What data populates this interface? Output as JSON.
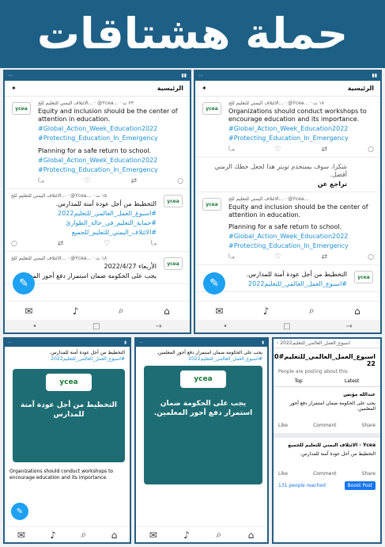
{
  "banner": {
    "title": "حملة هشتاقات"
  },
  "left": {
    "home": "الرئيسية",
    "org": "الائتلاف اليمني للتعليم للج...",
    "handle": "@Ycea...",
    "time": "٢٣ ت",
    "t1": "Equity and inclusion should be the center of attention in education.",
    "tags": [
      "#Global_Action_Week_Education2022",
      "#Protecting_Education_In_Emergency"
    ],
    "t1b": "Planning for a safe return to school.",
    "tags2": [
      "#Global_Action_Week_Education2022",
      "#Protecting_Education_In_Emergency"
    ],
    "meta2": "١٥ ت",
    "t2": "التخطيط من أجل عودة آمنة للمدارس.",
    "tags3": [
      "#اسبوع_العمل_العالمي_للتعليم2022",
      "#حماية_التعليم_في_حالة_الطوارئ",
      "#الائتلاف_اليمني_للتعليم_للجميع"
    ],
    "date": "الأربعاء 2022/4/27",
    "t3": "يجب على الحكومة ضمان استمرار دفع أجور المعلمين.",
    "meta3": "١٨ ت"
  },
  "right": {
    "home": "الرئيسية",
    "org": "الائتلاف اليمني للتعليم للج...",
    "handle": "@Ycea...",
    "time": "١٧ ت",
    "t1": "Organizations should conduct workshops to encourage education and its importance.",
    "tags": [
      "#Global_Action_Week_Education2022",
      "#Protecting_Education_In_Emergency"
    ],
    "note": "شكرا، سوف يستخدم تويتر هذا لجعل خطك الزمني أفضل.",
    "undo": "تراجع عن",
    "t2": "Equity and inclusion should be the center of attention in education.",
    "t2b": "Planning for a safe return to school.",
    "tags2": [
      "#Global_Action_Week_Education2022",
      "#Protecting_Education_In_Emergency"
    ],
    "t3": "التخطيط من أجل عودة آمنة للمدارس.",
    "tag3": "#اسبوع_العمل_العالمي_للتعليم2022"
  },
  "bottom": {
    "a_text": "التخطيط من أجل عودة آمنة للمدارس",
    "a_title": "التخطيط من أجل عودة آمنة للمدارس.",
    "a_tags": "#اسبوع_العمل_العالمي_للتعليم2022",
    "a_eng": "Organizations should conduct workshops to encourage education and its importance.",
    "b_title": "يجب على الحكومة ضمان استمرار دفع أجور المعلمين.",
    "b_tags": "#اسبوع_العمل_العالمي_للتعليم2022",
    "fb_title": "اسبوع_العمل_العالمي_للتعليم#20 22",
    "fb_sub": "People are posting about this",
    "fb_top": "Top",
    "fb_latest": "Latest",
    "fb_user": "عبدالله مؤنس",
    "fb_post": "يجب على الحكومة ضمان استمرار دفع أجور المعلمين.",
    "fb_like": "Like",
    "fb_comment": "Comment",
    "fb_share": "Share",
    "fb_page": "Ycea - الائتلاف اليمني للتعليم للجميع",
    "fb_text": "التخطيط من أجل عودة آمنة للمدارس.",
    "fb_reach": "131 people reached",
    "fb_boost": "Boost Post"
  }
}
